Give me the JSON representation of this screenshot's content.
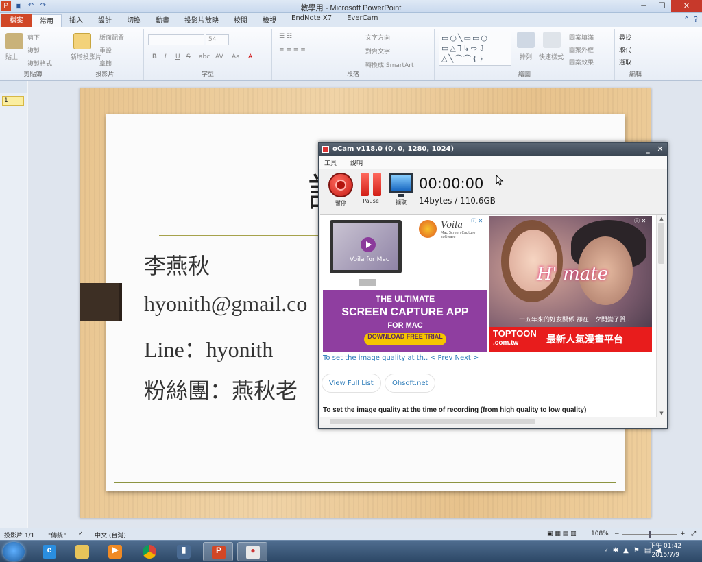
{
  "window": {
    "app_icon": "P",
    "title": "教學用 - Microsoft PowerPoint",
    "qat_icons": [
      "save-icon",
      "undo-icon",
      "redo-icon"
    ],
    "controls": [
      "─",
      "❐",
      "✕"
    ]
  },
  "tabs": [
    {
      "label": "檔案",
      "kind": "file"
    },
    {
      "label": "常用",
      "active": true
    },
    {
      "label": "插入"
    },
    {
      "label": "設計"
    },
    {
      "label": "切換"
    },
    {
      "label": "動畫"
    },
    {
      "label": "投影片放映"
    },
    {
      "label": "校閱"
    },
    {
      "label": "檢視"
    },
    {
      "label": "EndNote X7"
    },
    {
      "label": "EverCam"
    }
  ],
  "ribbon": {
    "clipboard": {
      "paste": "貼上",
      "cut": "剪下",
      "copy": "複製",
      "format_painter": "複製格式",
      "label": "剪貼簿"
    },
    "slides": {
      "new_slide": "新增投影片",
      "layout": "版面配置",
      "reset": "重設",
      "section": "章節",
      "label": "投影片"
    },
    "font": {
      "size": "54",
      "bold": "B",
      "italic": "I",
      "underline": "U",
      "strike": "S",
      "shadow": "abc",
      "spacing": "AV",
      "case": "Aa",
      "color": "A",
      "label": "字型"
    },
    "paragraph": {
      "text_direction": "文字方向",
      "align_text": "對齊文字",
      "smartart": "轉換成 SmartArt",
      "label": "段落"
    },
    "drawing": {
      "arrange": "排列",
      "quick_styles": "快速樣式",
      "shape_fill": "圖案填滿",
      "shape_outline": "圖案外框",
      "shape_effects": "圖案效果",
      "label": "繪圖"
    },
    "editing": {
      "find": "尋找",
      "replace": "取代",
      "select": "選取",
      "label": "編輯"
    }
  },
  "thumbnails": {
    "slide_number": "1"
  },
  "slide": {
    "title": "講",
    "lines": [
      "李燕秋",
      "hyonith@gmail.co",
      "Line：hyonith",
      "粉絲團：燕秋老"
    ]
  },
  "ocam": {
    "title": "oCam v118.0 (0, 0, 1280, 1024)",
    "menu": [
      "工具",
      "說明"
    ],
    "record_label": "暫停",
    "pause_label": "Pause",
    "capture_label": "擷取",
    "timer": "00:00:00",
    "size": "14bytes / 110.6GB",
    "ad1": {
      "mac_text": "Voila for Mac",
      "brand": "Voila",
      "brand_sub": "Mac Screen Capture software",
      "line1": "THE ULTIMATE",
      "line2": "SCREEN CAPTURE APP",
      "line3": "FOR MAC",
      "button": "DOWNLOAD FREE TRIAL"
    },
    "ad2": {
      "logo_text": "H' mate",
      "caption": "十五年來的好友關係 卻在一夕間變了質..",
      "brand_top": "TOPTOON",
      "brand_bottom": ".com.tw",
      "slogan": "最新人氣漫畫平台"
    },
    "ad_choices": "ⓘ ✕",
    "quality_link": "To set the image quality at th..",
    "pager": "< Prev Next >",
    "view_full_list": "View Full List",
    "ohsoft": "Ohsoft.net",
    "settings_heading": "To set the image quality at the time of recording (from high quality to low quality)"
  },
  "statusbar": {
    "slide_info": "投影片 1/1",
    "theme": "\"傳統\"",
    "language": "中文 (台灣)",
    "zoom": "108%",
    "zoom_out": "−",
    "zoom_in": "+"
  },
  "taskbar": {
    "apps": [
      "ie-icon",
      "explorer-icon",
      "media-player-icon",
      "chrome-icon",
      "tool-icon",
      "powerpoint-icon",
      "ocam-icon"
    ],
    "time": "下午 01:42",
    "date": "2015/7/9"
  },
  "colors": {
    "file_tab": "#d04727",
    "ocam_title": "#3a4552",
    "ad_purple": "#8f3ea0",
    "ad_red": "#e81c1c",
    "link": "#2a7ab8"
  }
}
